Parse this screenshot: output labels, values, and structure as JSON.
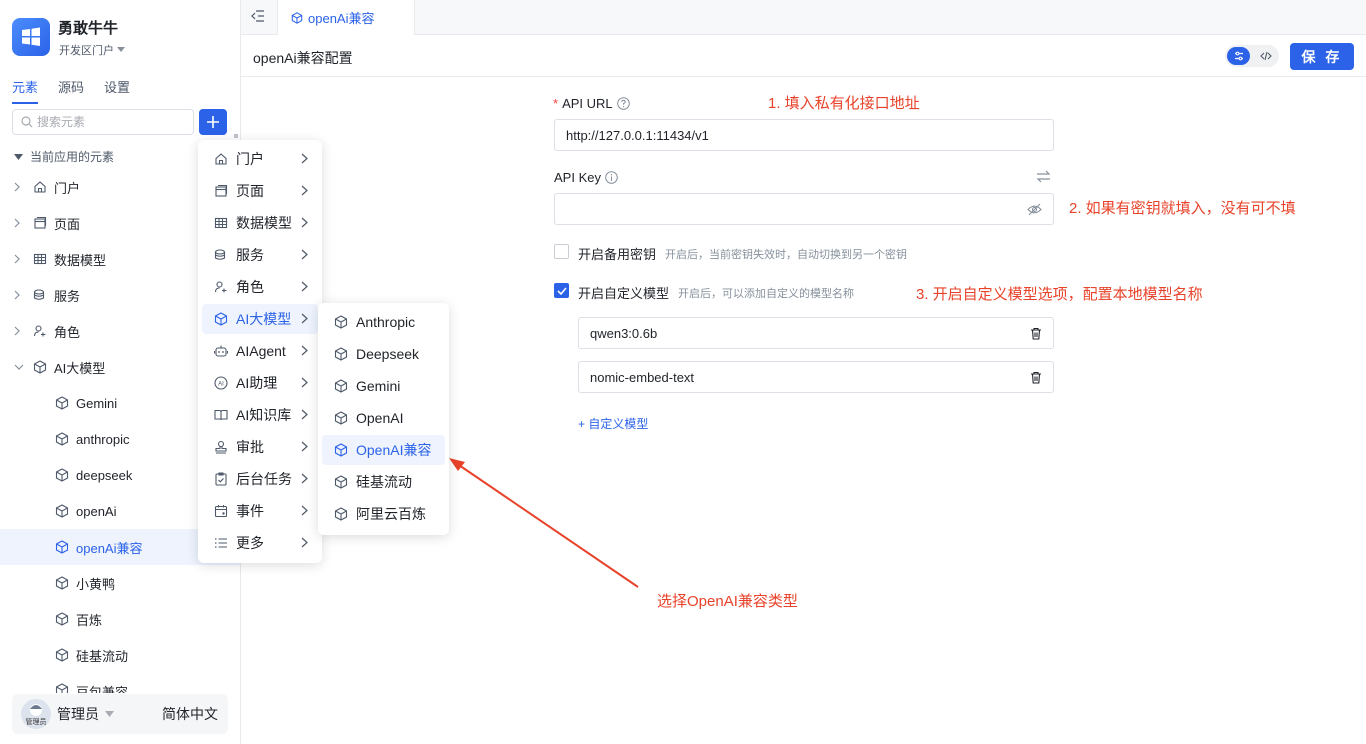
{
  "app": {
    "name": "勇敢牛牛",
    "sub": "开发区门户"
  },
  "sidebar": {
    "tabs": [
      "元素",
      "源码",
      "设置"
    ],
    "search_placeholder": "搜索元素",
    "section": "当前应用的元素",
    "items": [
      {
        "label": "门户"
      },
      {
        "label": "页面"
      },
      {
        "label": "数据模型"
      },
      {
        "label": "服务"
      },
      {
        "label": "角色"
      },
      {
        "label": "AI大模型"
      },
      {
        "label": "Gemini"
      },
      {
        "label": "anthropic"
      },
      {
        "label": "deepseek"
      },
      {
        "label": "openAi"
      },
      {
        "label": "openAi兼容"
      },
      {
        "label": "小黄鸭"
      },
      {
        "label": "百炼"
      },
      {
        "label": "硅基流动"
      },
      {
        "label": "豆包兼容"
      }
    ],
    "footer": {
      "avatar_text": "管理员",
      "user": "管理员",
      "lang": "简体中文"
    }
  },
  "header": {
    "tab": "openAi兼容",
    "title": "openAi兼容配置",
    "save": "保 存"
  },
  "form": {
    "api_url_label": "API URL",
    "api_url_value": "http://127.0.0.1:11434/v1",
    "api_key_label": "API Key",
    "api_key_value": "",
    "backup_key_label": "开启备用密钥",
    "backup_key_hint": "开启后，当前密钥失效时，自动切换到另一个密钥",
    "custom_model_label": "开启自定义模型",
    "custom_model_hint": "开启后，可以添加自定义的模型名称",
    "models": [
      "qwen3:0.6b",
      "nomic-embed-text"
    ],
    "add_model": "+ 自定义模型"
  },
  "annotations": {
    "a1": "1. 填入私有化接口地址",
    "a2": "2. 如果有密钥就填入，没有可不填",
    "a3": "3. 开启自定义模型选项，配置本地模型名称",
    "a4": "选择OpenAI兼容类型"
  },
  "menu": {
    "items": [
      "门户",
      "页面",
      "数据模型",
      "服务",
      "角色",
      "AI大模型",
      "AIAgent",
      "AI助理",
      "AI知识库",
      "审批",
      "后台任务",
      "事件",
      "更多"
    ]
  },
  "submenu": {
    "items": [
      "Anthropic",
      "Deepseek",
      "Gemini",
      "OpenAI",
      "OpenAI兼容",
      "硅基流动",
      "阿里云百炼"
    ]
  },
  "colors": {
    "primary": "#2b62e8",
    "annotation": "#e8432a"
  }
}
